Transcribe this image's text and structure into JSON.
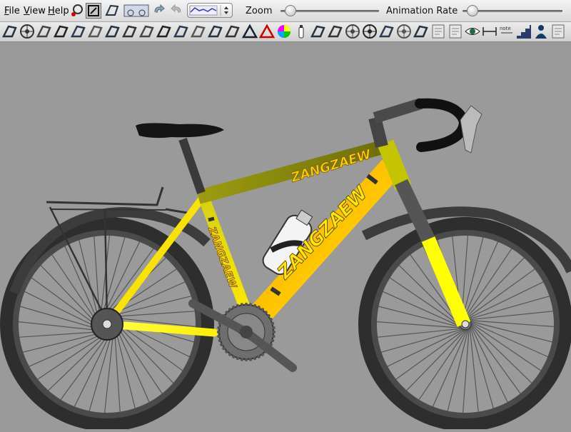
{
  "menu": {
    "file": "File",
    "view": "View",
    "help": "Help"
  },
  "toolbar": {
    "zoom_label": "Zoom",
    "zoom_value": 0.05,
    "animation_label": "Animation Rate",
    "animation_value": 0.05
  },
  "parts_bar": {
    "icons": [
      "frame-icon",
      "wheel-icon",
      "fork-icon",
      "crank-icon",
      "pedal-icon",
      "chain-icon",
      "derailleur-icon",
      "shifter-icon",
      "brake-icon",
      "stem-icon",
      "handlebar-icon",
      "seat-icon",
      "rider-icon",
      "tube-icon",
      "triangle-icon",
      "triangle-red-icon",
      "color-wheel-icon",
      "bottle-icon",
      "angle-icon",
      "angle2-icon",
      "cassette-icon",
      "gear-icon",
      "tools-icon",
      "hub-icon",
      "spoke-icon",
      "document-icon",
      "texture-icon",
      "eye-icon",
      "dimension-icon",
      "note-icon",
      "stairs-icon",
      "person-icon",
      "background-icon"
    ],
    "note_label": "note"
  },
  "bike": {
    "brand_text": "ZANGZAEW",
    "colors": {
      "frame": "#ffe600",
      "frame_dark": "#8a8a12",
      "tire": "#333333",
      "spoke": "#555555",
      "background": "#9a9a9a",
      "saddle": "#151515",
      "bottle": "#f4f4f4"
    }
  }
}
